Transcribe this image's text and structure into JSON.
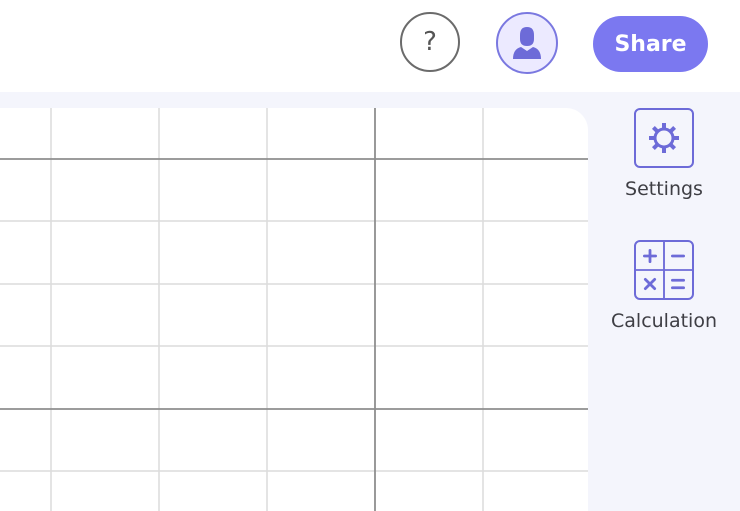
{
  "header": {
    "help_icon_glyph": "?",
    "share_label": "Share"
  },
  "sidebar": {
    "settings_label": "Settings",
    "calculation_label": "Calculation"
  },
  "colors": {
    "accent": "#7b78f0",
    "sidebar_bg": "#f4f5fc",
    "grid_minor": "#dcdcdc",
    "grid_major": "#8e8e8e"
  }
}
